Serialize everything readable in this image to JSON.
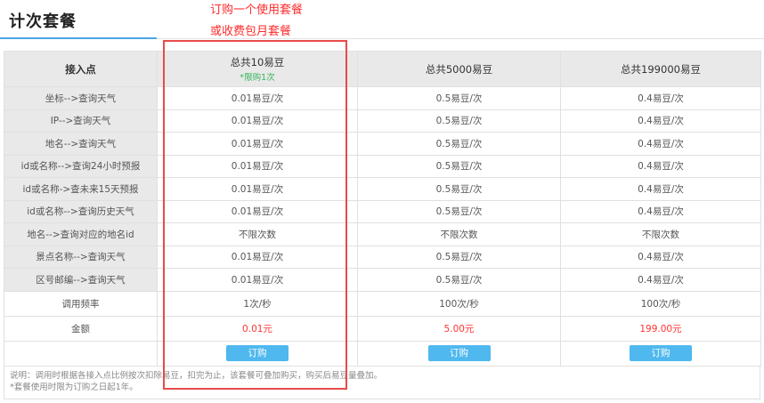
{
  "page": {
    "title": "计次套餐"
  },
  "annotation": {
    "line1": "订购一个使用套餐",
    "line2": "或收费包月套餐"
  },
  "table": {
    "corner_header": "接入点",
    "plans": [
      {
        "name": "总共10易豆",
        "badge": "*限购1次"
      },
      {
        "name": "总共5000易豆",
        "badge": ""
      },
      {
        "name": "总共199000易豆",
        "badge": ""
      }
    ],
    "rows": [
      {
        "label": "坐标-->查询天气",
        "values": [
          "0.01易豆/次",
          "0.5易豆/次",
          "0.4易豆/次"
        ]
      },
      {
        "label": "IP-->查询天气",
        "values": [
          "0.01易豆/次",
          "0.5易豆/次",
          "0.4易豆/次"
        ]
      },
      {
        "label": "地名-->查询天气",
        "values": [
          "0.01易豆/次",
          "0.5易豆/次",
          "0.4易豆/次"
        ]
      },
      {
        "label": "id或名称-->查询24小时预报",
        "values": [
          "0.01易豆/次",
          "0.5易豆/次",
          "0.4易豆/次"
        ]
      },
      {
        "label": "id或名称->查未来15天预报",
        "values": [
          "0.01易豆/次",
          "0.5易豆/次",
          "0.4易豆/次"
        ]
      },
      {
        "label": "id或名称-->查询历史天气",
        "values": [
          "0.01易豆/次",
          "0.5易豆/次",
          "0.4易豆/次"
        ]
      },
      {
        "label": "地名-->查询对应的地名id",
        "values": [
          "不限次数",
          "不限次数",
          "不限次数"
        ]
      },
      {
        "label": "景点名称-->查询天气",
        "values": [
          "0.01易豆/次",
          "0.5易豆/次",
          "0.4易豆/次"
        ]
      },
      {
        "label": "区号邮编-->查询天气",
        "values": [
          "0.01易豆/次",
          "0.5易豆/次",
          "0.4易豆/次"
        ]
      }
    ],
    "frequency": {
      "label": "调用频率",
      "values": [
        "1次/秒",
        "100次/秒",
        "100次/秒"
      ]
    },
    "amount": {
      "label": "金额",
      "values": [
        "0.01元",
        "5.00元",
        "199.00元"
      ]
    },
    "order_label": "订购"
  },
  "notes": {
    "line1": "说明：调用时根据各接入点比例按次扣除易豆，扣完为止，该套餐可叠加购买，购买后易豆量叠加。",
    "line2": "*套餐使用时限为订购之日起1年。"
  },
  "colors": {
    "accent": "#4aa6e6",
    "button": "#4fb8ee",
    "price": "#ff3333",
    "annotation": "#ff2a2a",
    "badge": "#35b45a"
  }
}
